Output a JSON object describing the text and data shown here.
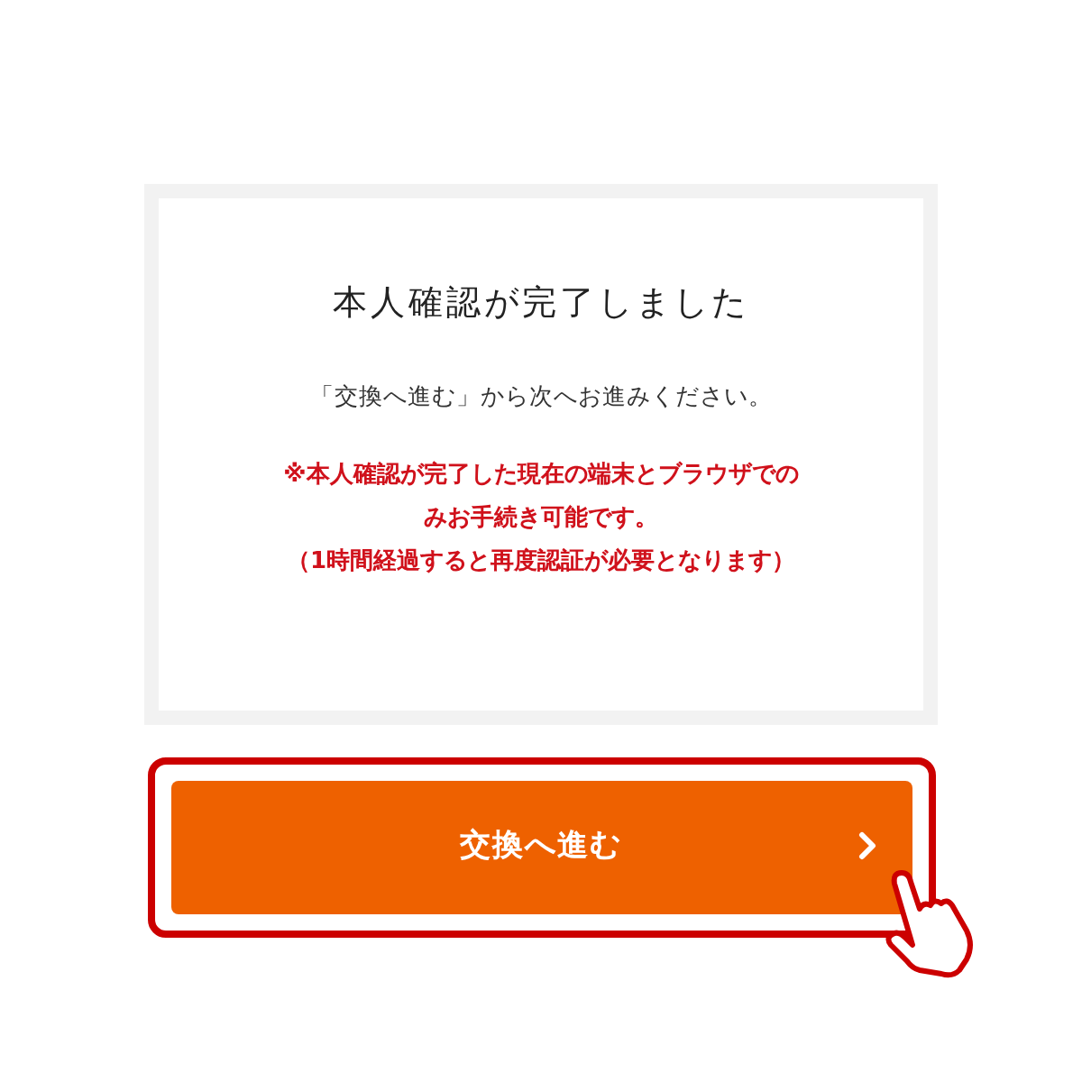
{
  "title": "本人確認が完了しました",
  "instruction": "「交換へ進む」から次へお進みください。",
  "notice_lines": [
    "※本人確認が完了した現在の端末とブラウザでの",
    "みお手続き可能です。",
    "（1時間経過すると再度認証が必要となります）"
  ],
  "button": {
    "label": "交換へ進む"
  }
}
